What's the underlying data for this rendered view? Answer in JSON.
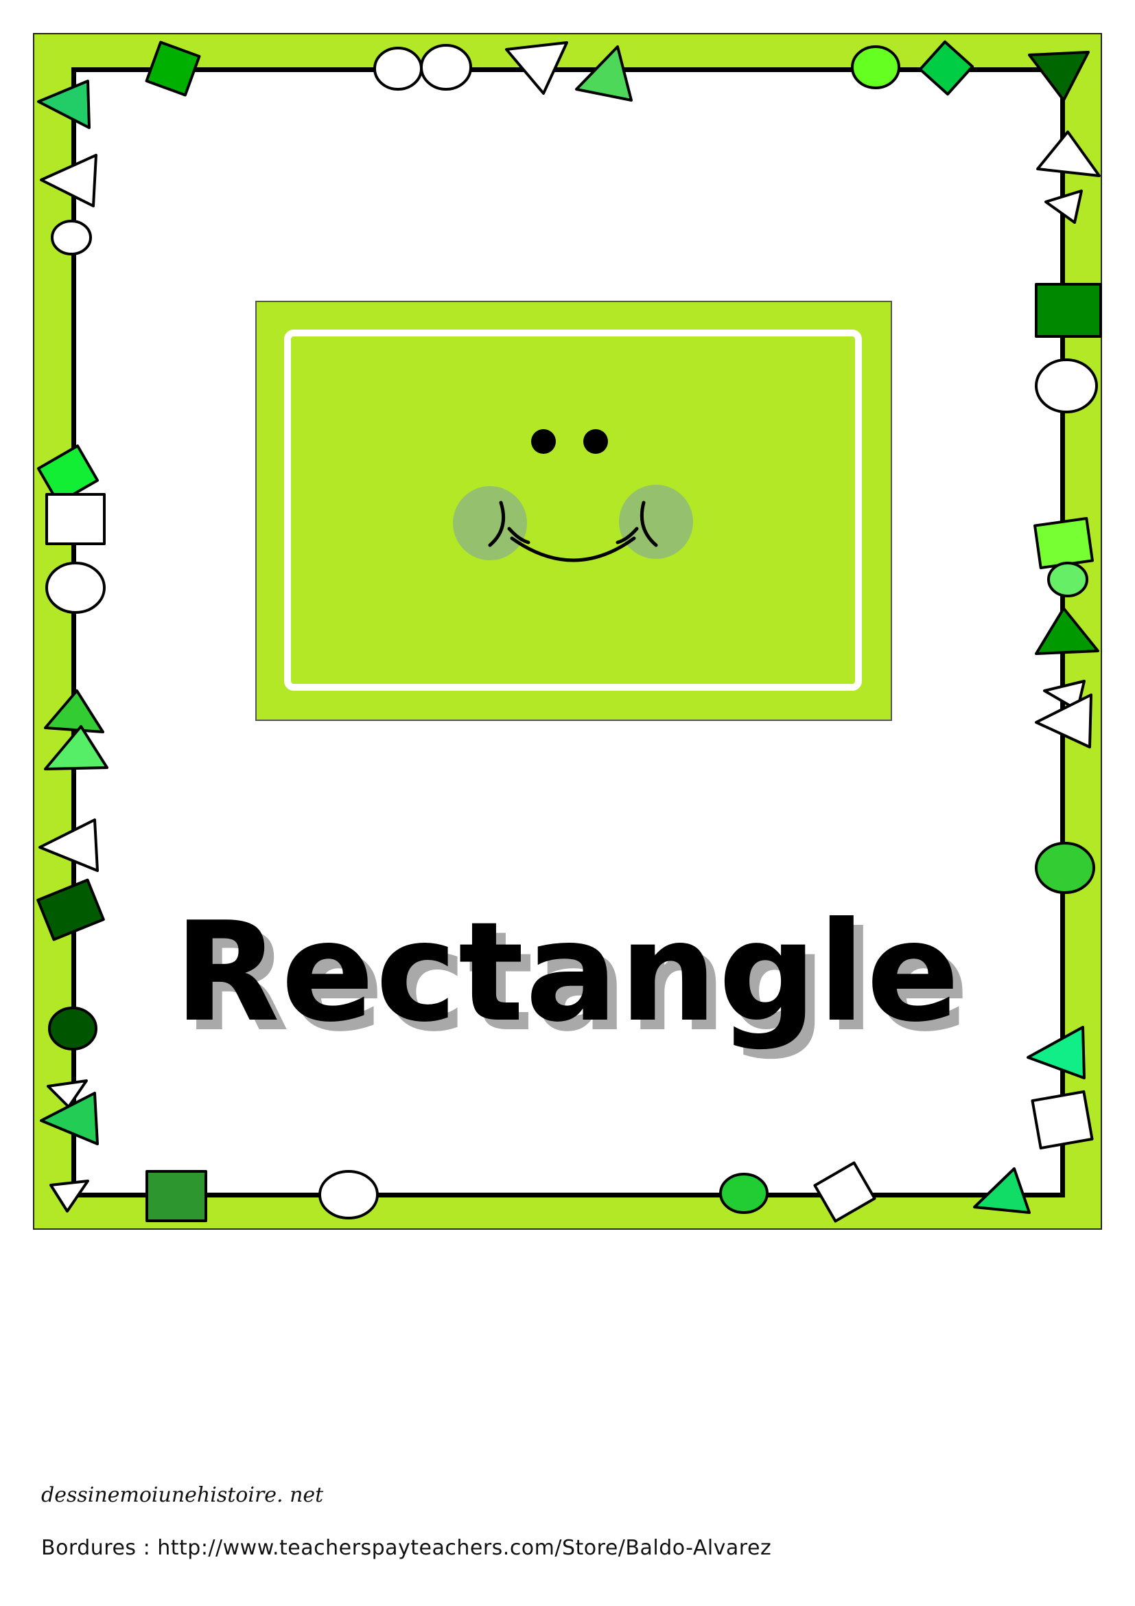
{
  "card": {
    "title": "Rectangle",
    "palette": {
      "border_green": "#b3e826",
      "dark_green": "#006b00",
      "mid_green": "#00a000",
      "bright_green": "#00e040",
      "light_green": "#33ff66",
      "yellow_green": "#88ff22",
      "cheek": "#8fb87a"
    }
  },
  "footer": {
    "site": "dessinemoiunehistoire. net",
    "border_credit": "Bordures : http://www.teacherspayteachers.com/Store/Baldo-Alvarez"
  }
}
